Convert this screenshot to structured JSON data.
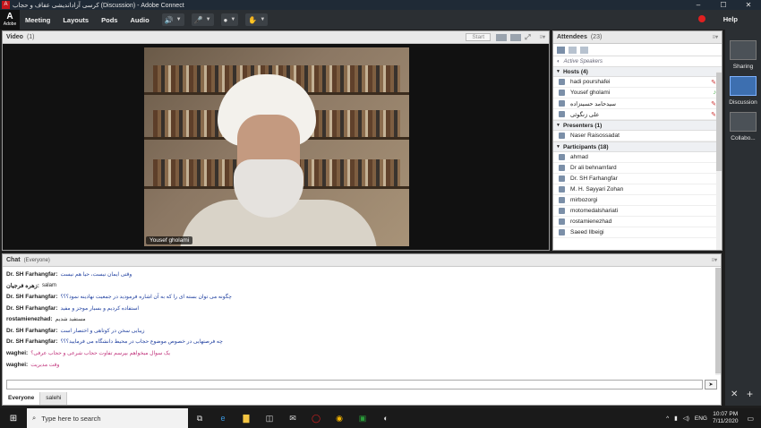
{
  "window": {
    "title": "کرسی آزاداندیشی عفاف و حجاب (Discussion) - Adobe Connect",
    "controls": [
      "–",
      "☐",
      "✕"
    ]
  },
  "menubar": {
    "logo_text": "Adobe",
    "items": [
      "Meeting",
      "Layouts",
      "Pods",
      "Audio"
    ],
    "help": "Help"
  },
  "video_pod": {
    "title": "Video",
    "count": "(1)",
    "start_label": "Start",
    "speaker_name": "Yousef gholami"
  },
  "attendees_pod": {
    "title": "Attendees",
    "count": "(23)",
    "active_speakers": "Active Speakers",
    "hosts_label": "Hosts (4)",
    "hosts": [
      "hadi pourshafei",
      "Yousef gholami",
      "سیدحامد حسینزاده",
      "علی زنگوئی"
    ],
    "presenters_label": "Presenters (1)",
    "presenters": [
      "Naser Raisossadat"
    ],
    "participants_label": "Participants (18)",
    "participants": [
      "ahmad",
      "Dr ali behnamfard",
      "Dr. SH Farhangfar",
      "M. H. Sayyari Zohan",
      "mirbozorgi",
      "motomedalshariati",
      "rostamienezhad",
      "Saeed Ilbeigi"
    ]
  },
  "chat_pod": {
    "title": "Chat",
    "scope": "(Everyone)",
    "messages": [
      {
        "who": "Dr. SH Farhangfar:",
        "msg": "وقتی ایمان نیست، حیا هم نیست",
        "style": "blue"
      },
      {
        "who": "زهره فرجیان:",
        "msg": "salam",
        "style": "black"
      },
      {
        "who": "Dr. SH Farhangfar:",
        "msg": "چگونه می توان بسته ای را که به آن اشاره فرمودید در جمعیت نهادینه نمود؟؟؟",
        "style": "blue"
      },
      {
        "who": "Dr. SH Farhangfar:",
        "msg": "استفاده کردیم و بسیار موجز و مفید",
        "style": "blue"
      },
      {
        "who": "rostamienezhad:",
        "msg": "مستفید شدیم",
        "style": "black"
      },
      {
        "who": "Dr. SH Farhangfar:",
        "msg": "زیبایی سخن در کوتاهی و اختصار است",
        "style": "blue"
      },
      {
        "who": "Dr. SH Farhangfar:",
        "msg": "چه فرصتهایی در خصوص موضوع حجاب در محیط دانشگاه می فرمایید؟؟؟",
        "style": "blue"
      },
      {
        "who": "waghei:",
        "msg": "یک سوال میخواهم بپرسم تفاوت حجاب شرعی و حجاب عرفی؟",
        "style": "pink"
      },
      {
        "who": "waghei:",
        "msg": "وقت  مدیریت",
        "style": "pink"
      }
    ],
    "tabs": [
      "Everyone",
      "salehi"
    ]
  },
  "layouts_bar": {
    "items": [
      "Sharing",
      "Discussion",
      "Collabo..."
    ]
  },
  "taskbar": {
    "search_placeholder": "Type here to search",
    "lang": "ENG",
    "time": "10:07 PM",
    "date": "7/11/2020"
  },
  "colors": {
    "menubar": "#2b2f33",
    "accent": "#3d6fb0",
    "record": "#e02020"
  }
}
